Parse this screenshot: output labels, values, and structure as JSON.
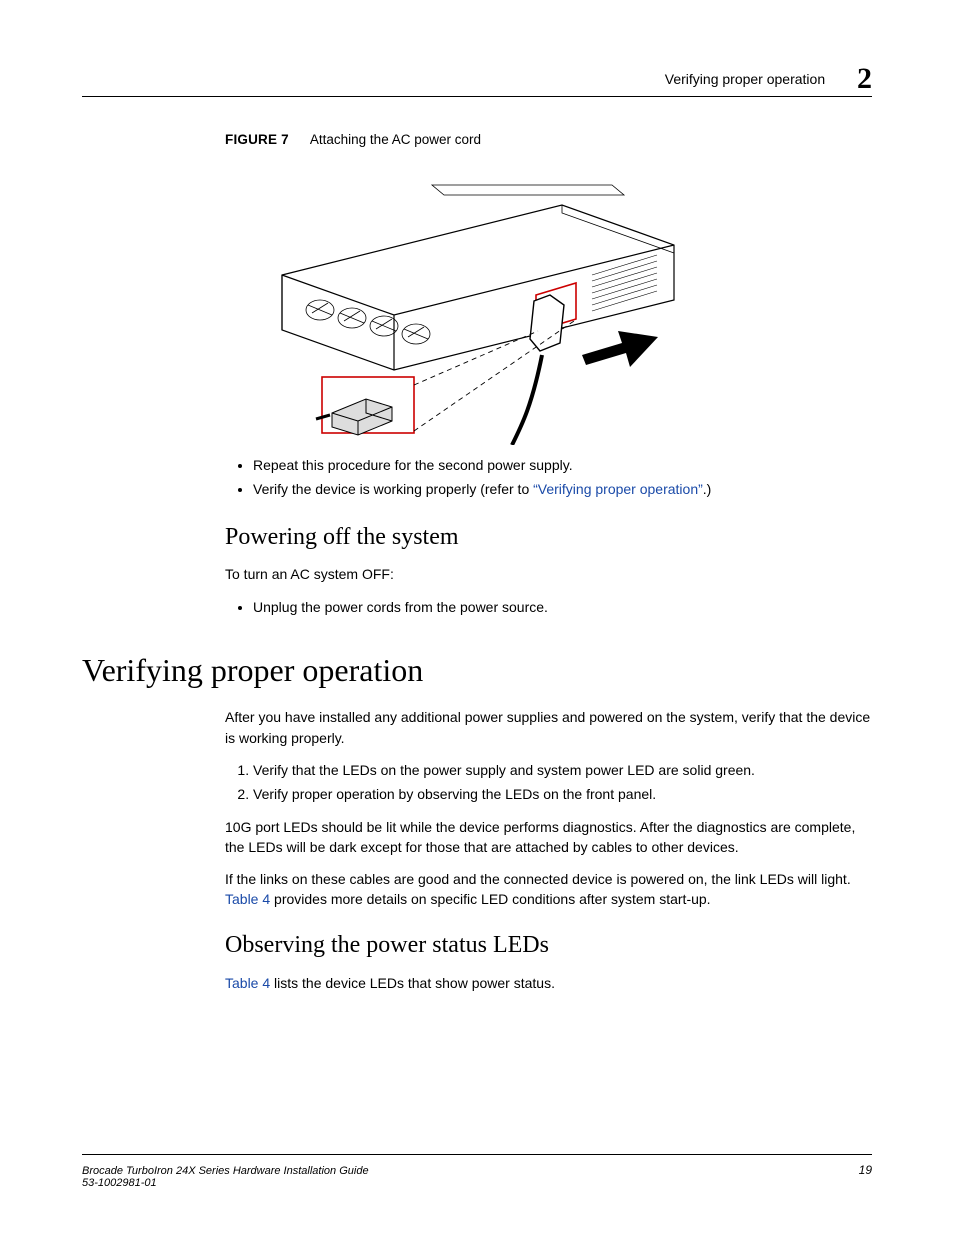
{
  "header": {
    "running_title": "Verifying proper operation",
    "chapter_number": "2"
  },
  "figure": {
    "label": "FIGURE 7",
    "caption": "Attaching the AC power cord"
  },
  "bullets_after_figure": [
    {
      "text": "Repeat this procedure for the second power supply."
    },
    {
      "prefix": "Verify the device is working properly (refer to ",
      "link": "“Verifying proper operation”",
      "suffix": ".)"
    }
  ],
  "powering_off": {
    "heading": "Powering off the system",
    "intro": "To turn an AC system OFF:",
    "bullet": "Unplug the power cords from the power source."
  },
  "verifying": {
    "heading": "Verifying proper operation",
    "intro": "After you have installed any additional power supplies and powered on the system, verify that the device is working properly.",
    "steps": [
      "Verify that the LEDs on the power supply and system power LED are solid green.",
      "Verify proper operation by observing the LEDs on the front panel."
    ],
    "para1": "10G port LEDs should be lit while the device performs diagnostics. After the diagnostics are complete, the LEDs will be dark except for those that are attached by cables to other devices.",
    "para2_prefix": "If the links on these cables are good and the connected device is powered on, the link LEDs will light. ",
    "para2_link": "Table 4",
    "para2_suffix": " provides more details on specific LED conditions after system start-up."
  },
  "observing": {
    "heading": "Observing the power status LEDs",
    "para_link": "Table 4",
    "para_suffix": " lists the device LEDs that show power status."
  },
  "footer": {
    "line1": "Brocade TurboIron 24X Series Hardware Installation Guide",
    "line2": "53-1002981-01",
    "page": "19"
  }
}
